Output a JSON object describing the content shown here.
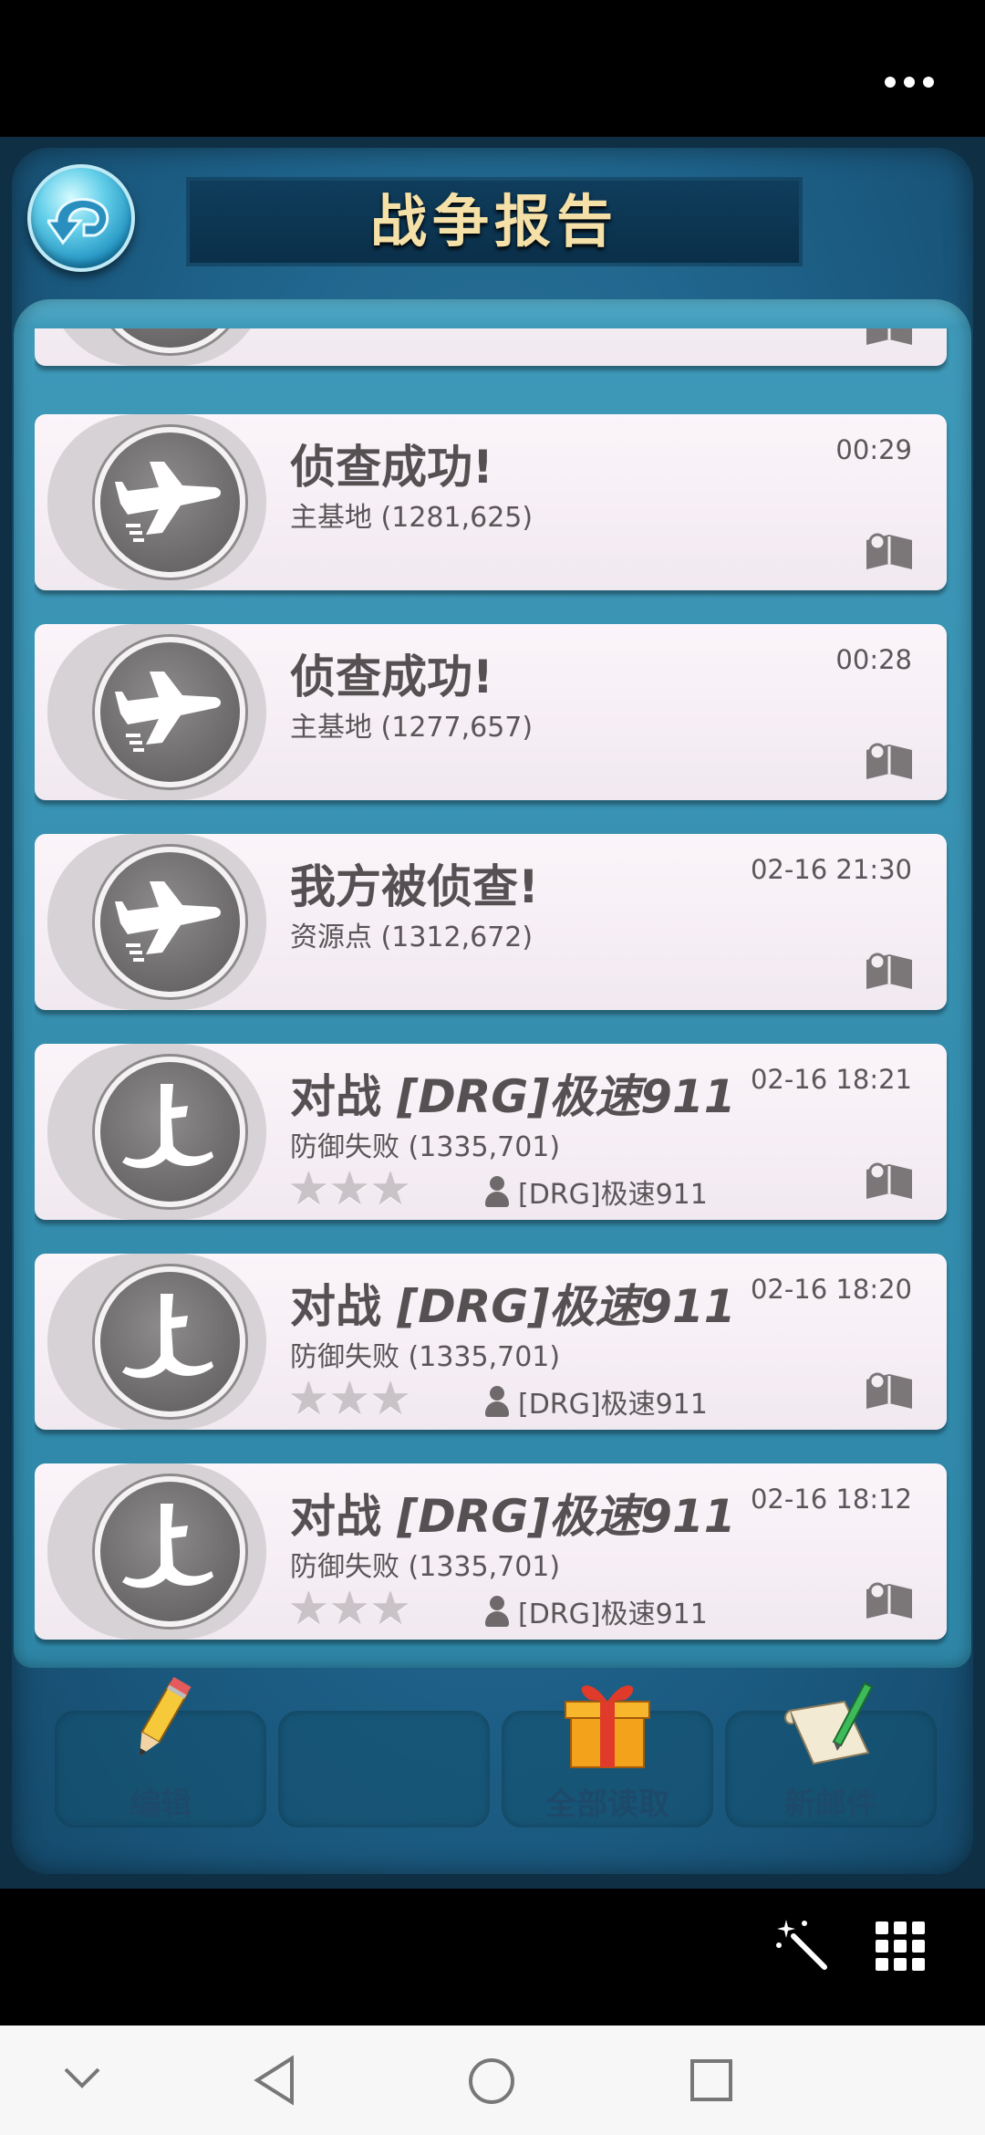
{
  "header": {
    "title": "战争报告",
    "more_icon": "more-horizontal-icon",
    "back_icon": "back-arrow-icon"
  },
  "reports": [
    {
      "type": "scout",
      "title": "侦查成功!",
      "location": "主基地 (1281,625)",
      "time": "00:29"
    },
    {
      "type": "scout",
      "title": "侦查成功!",
      "location": "主基地 (1277,657)",
      "time": "00:28"
    },
    {
      "type": "scout",
      "title": "我方被侦查!",
      "location": "资源点 (1312,672)",
      "time": "02-16 21:30"
    },
    {
      "type": "battle",
      "title_prefix": "对战 ",
      "title_tag": "[DRG]",
      "title_name": "极速911",
      "location": "防御失败 (1335,701)",
      "time": "02-16 18:21",
      "stars": "★★★",
      "opponent": "[DRG]极速911"
    },
    {
      "type": "battle",
      "title_prefix": "对战 ",
      "title_tag": "[DRG]",
      "title_name": "极速911",
      "location": "防御失败 (1335,701)",
      "time": "02-16 18:20",
      "stars": "★★★",
      "opponent": "[DRG]极速911"
    },
    {
      "type": "battle",
      "title_prefix": "对战 ",
      "title_tag": "[DRG]",
      "title_name": "极速911",
      "location": "防御失败 (1335,701)",
      "time": "02-16 18:12",
      "stars": "★★★",
      "opponent": "[DRG]极速911"
    }
  ],
  "toolbar": {
    "edit_label": "编辑",
    "read_all_label": "全部读取",
    "new_mail_label": "新邮件"
  },
  "system": {
    "icons": [
      "magic-wand-icon",
      "grid-menu-icon",
      "nav-down-icon",
      "nav-back-icon",
      "nav-home-icon",
      "nav-recents-icon"
    ]
  }
}
